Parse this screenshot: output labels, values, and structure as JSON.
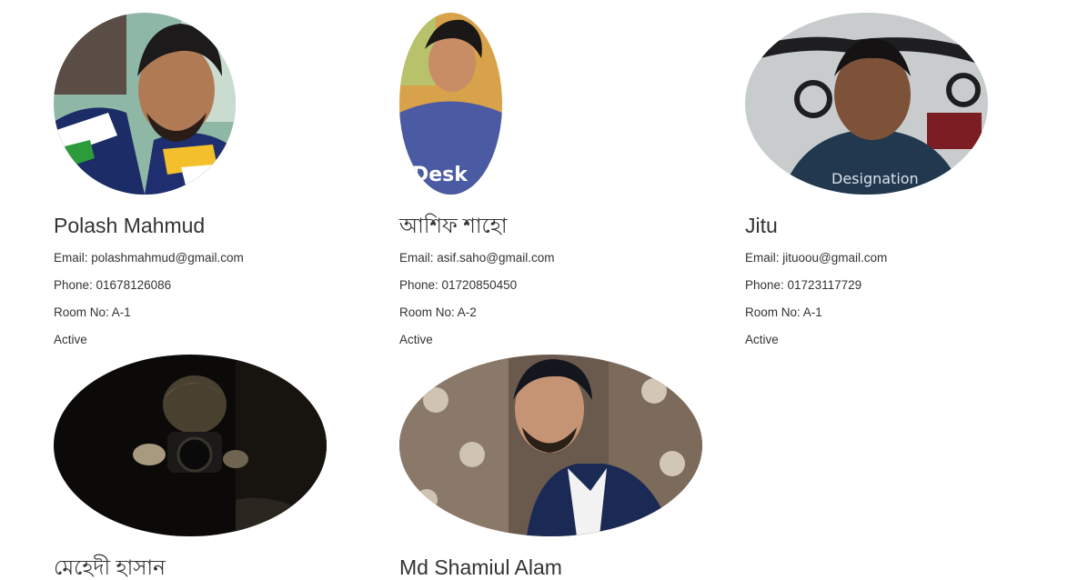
{
  "members": [
    {
      "name": "Polash Mahmud",
      "email": "Email: polashmahmud@gmail.com",
      "phone": "Phone: 01678126086",
      "room": "Room No: A-1",
      "status": "Active"
    },
    {
      "name": "আশিফ শাহো",
      "email": "Email: asif.saho@gmail.com",
      "phone": "Phone: 01720850450",
      "room": "Room No: A-2",
      "status": "Active"
    },
    {
      "name": "Jitu",
      "email": "Email: jituoou@gmail.com",
      "phone": "Phone: 01723117729",
      "room": "Room No: A-1",
      "status": "Active"
    },
    {
      "name": "মেহেদী হাসান"
    },
    {
      "name": "Md Shamiul Alam"
    }
  ],
  "colors": {
    "text": "#333333",
    "background": "#ffffff"
  }
}
